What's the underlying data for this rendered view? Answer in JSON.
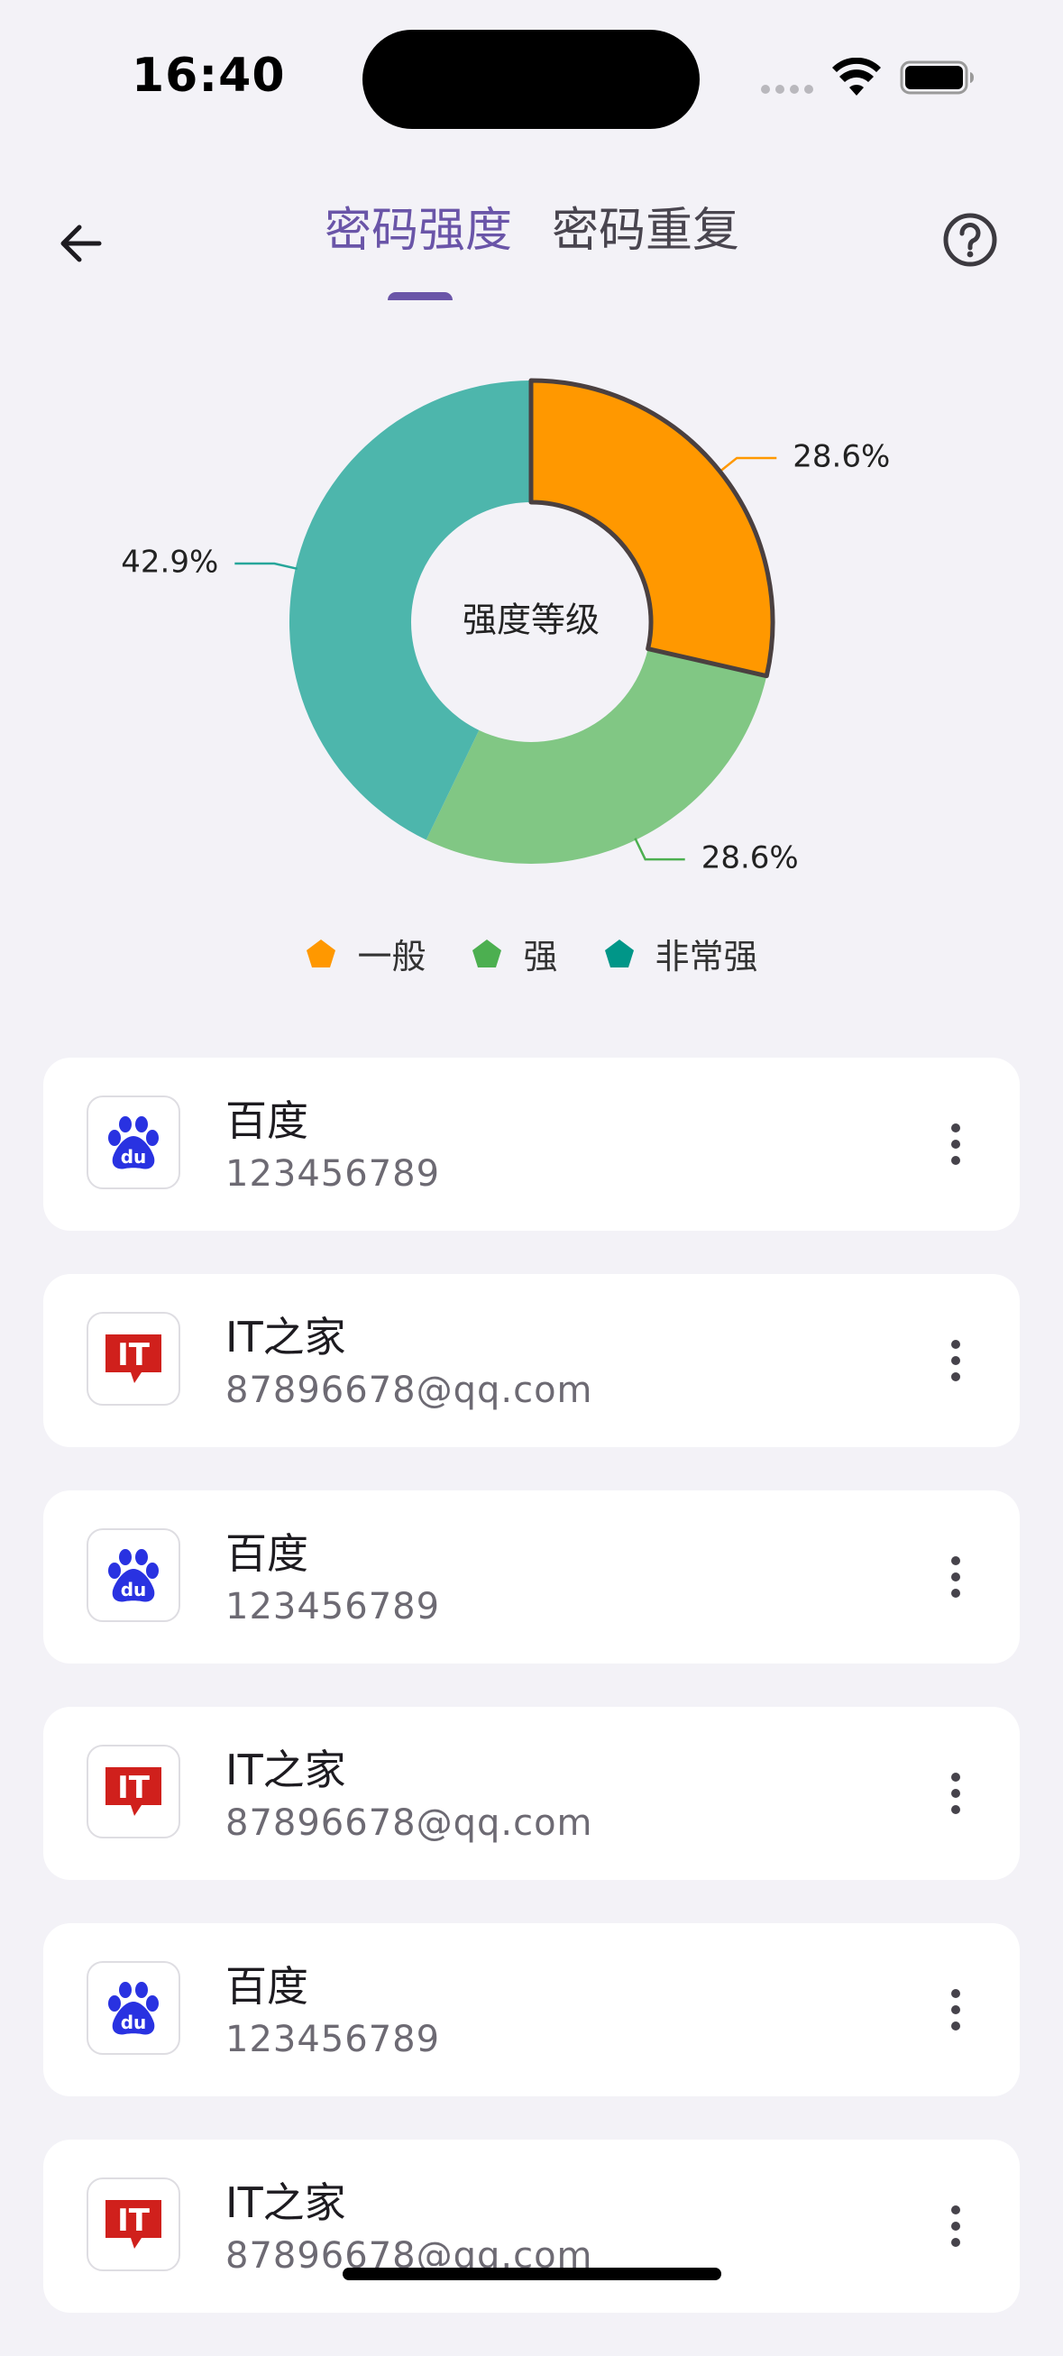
{
  "status": {
    "time": "16:40"
  },
  "header": {
    "tabs": [
      {
        "label": "密码强度",
        "active": true
      },
      {
        "label": "密码重复",
        "active": false
      }
    ],
    "back_icon": "arrow-left-icon",
    "help_icon": "help-circle-icon"
  },
  "chart_data": {
    "type": "pie",
    "donut": true,
    "center_label": "强度等级",
    "categories": [
      "一般",
      "强",
      "非常强"
    ],
    "values": [
      28.6,
      28.6,
      42.9
    ],
    "value_labels": [
      "28.6%",
      "28.6%",
      "42.9%"
    ],
    "colors": [
      "#ff9800",
      "#81c784",
      "#4db6ac"
    ],
    "highlighted": "一般",
    "legend_position": "bottom",
    "legend_marker": "pentagon",
    "legend_colors": [
      "#ff9800",
      "#4caf50",
      "#009688"
    ]
  },
  "accounts": [
    {
      "name": "百度",
      "account": "123456789",
      "logo": "baidu-logo-icon"
    },
    {
      "name": "IT之家",
      "account": "87896678@qq.com",
      "logo": "ithome-logo-icon"
    },
    {
      "name": "百度",
      "account": "123456789",
      "logo": "baidu-logo-icon"
    },
    {
      "name": "IT之家",
      "account": "87896678@qq.com",
      "logo": "ithome-logo-icon"
    },
    {
      "name": "百度",
      "account": "123456789",
      "logo": "baidu-logo-icon"
    },
    {
      "name": "IT之家",
      "account": "87896678@qq.com",
      "logo": "ithome-logo-icon"
    }
  ],
  "colors": {
    "accent": "#6a55a8",
    "background": "#f3f2f7",
    "card": "#ffffff",
    "ithome_red": "#d0201c",
    "baidu_blue": "#2932e1"
  }
}
